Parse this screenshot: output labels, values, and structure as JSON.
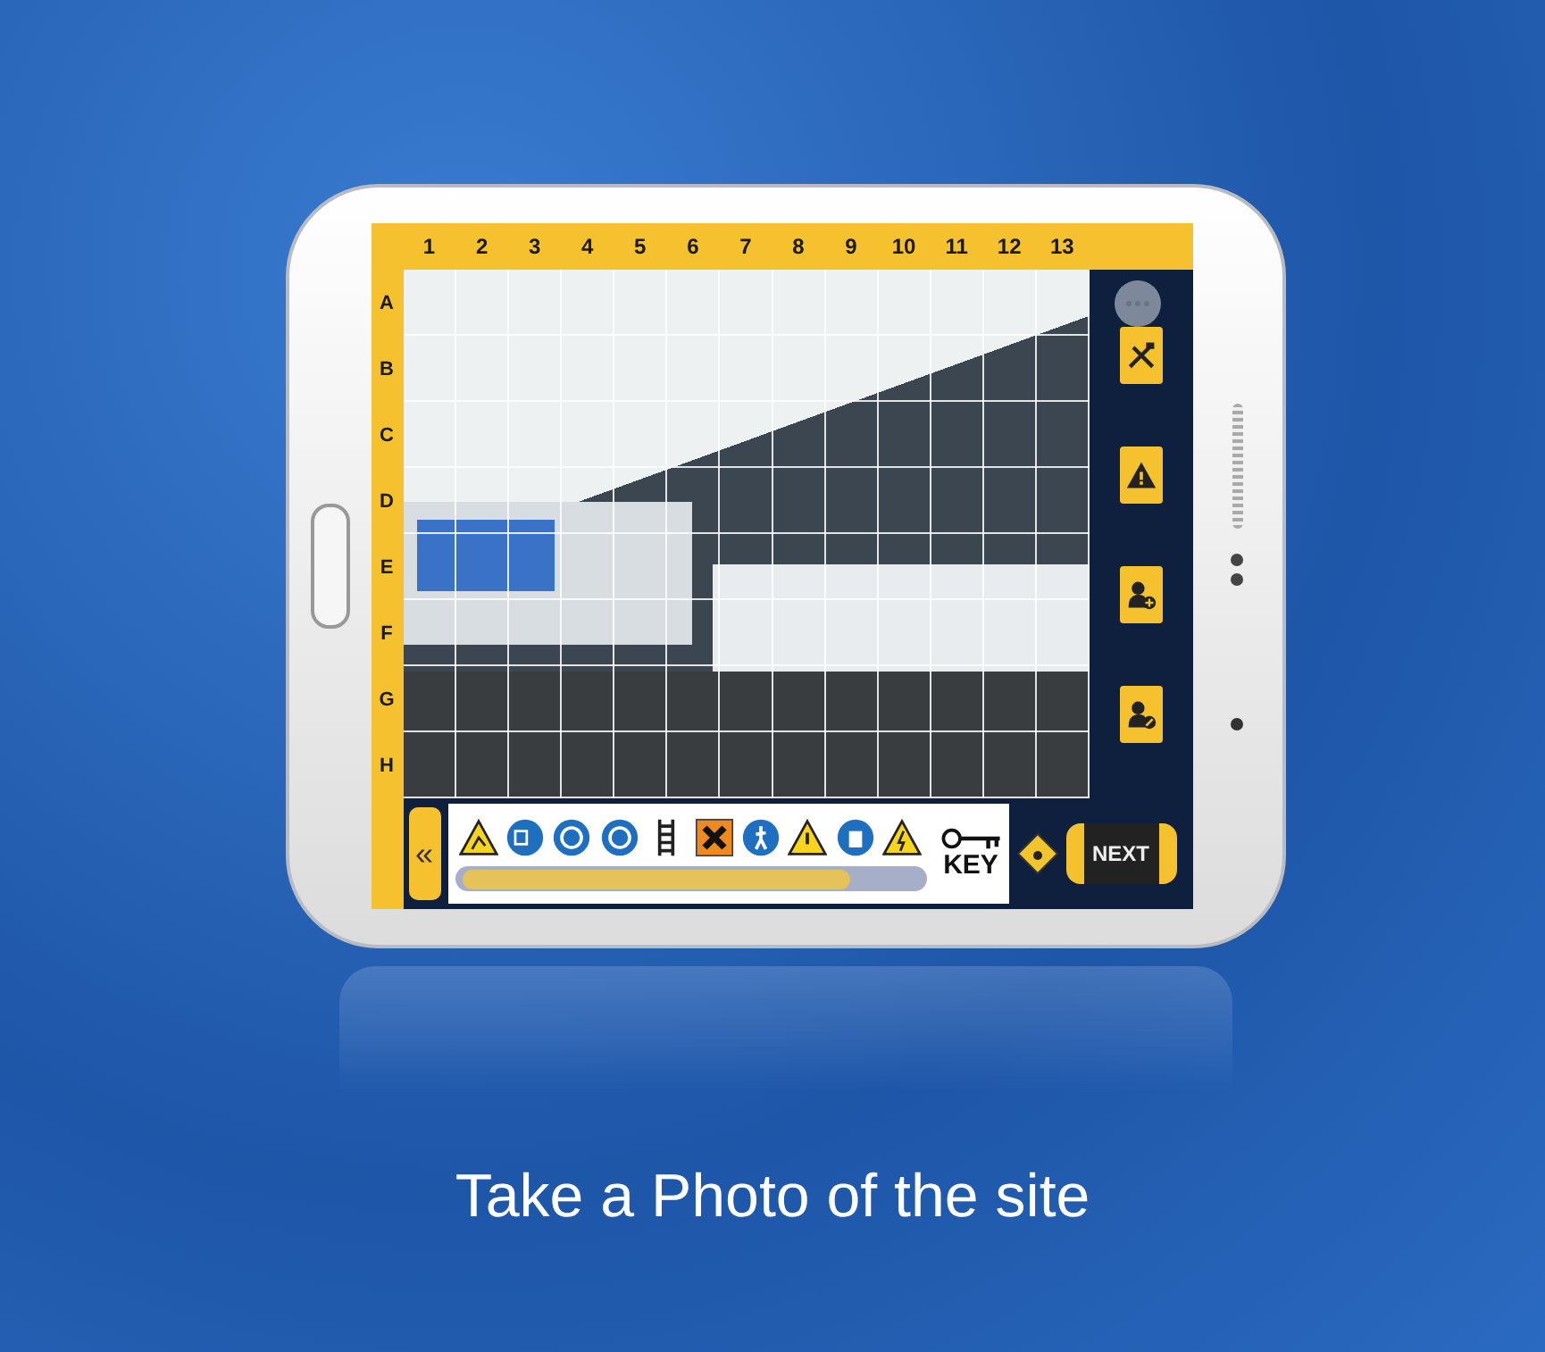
{
  "grid": {
    "columns": [
      "1",
      "2",
      "3",
      "4",
      "5",
      "6",
      "7",
      "8",
      "9",
      "10",
      "11",
      "12",
      "13"
    ],
    "rows": [
      "A",
      "B",
      "C",
      "D",
      "E",
      "F",
      "G",
      "H"
    ]
  },
  "side_tools": [
    {
      "kind": "tools"
    },
    {
      "kind": "warning"
    },
    {
      "kind": "person-add"
    },
    {
      "kind": "person-edit"
    }
  ],
  "toolbar": {
    "back": "«",
    "signs": [
      {
        "kind": "slip"
      },
      {
        "kind": "plug"
      },
      {
        "kind": "helmet"
      },
      {
        "kind": "ear"
      },
      {
        "kind": "ladder"
      },
      {
        "kind": "harmful"
      },
      {
        "kind": "walk"
      },
      {
        "kind": "warning"
      },
      {
        "kind": "bin"
      },
      {
        "kind": "electric"
      }
    ],
    "key_label": "KEY",
    "next": "NEXT"
  },
  "caption": "Take a Photo of the site"
}
